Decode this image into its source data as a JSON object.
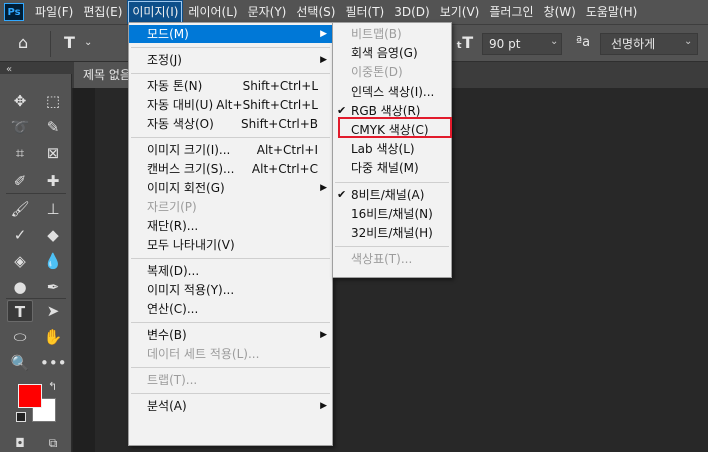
{
  "app_logo": "Ps",
  "menubar": [
    "파일(F)",
    "편집(E)",
    "이미지(I)",
    "레이어(L)",
    "문자(Y)",
    "선택(S)",
    "필터(T)",
    "3D(D)",
    "보기(V)",
    "플러그인",
    "창(W)",
    "도움말(H)"
  ],
  "options": {
    "font_size": "90 pt",
    "aa_icon": "ªa",
    "antialias": "선명하게"
  },
  "document_tab": "제목 없음",
  "image_menu": [
    {
      "label": "모드(M)",
      "submenu": true,
      "highlight": true
    },
    {
      "sep": true
    },
    {
      "label": "조정(J)",
      "submenu": true
    },
    {
      "sep": true
    },
    {
      "label": "자동 톤(N)",
      "shortcut": "Shift+Ctrl+L"
    },
    {
      "label": "자동 대비(U)",
      "shortcut": "Alt+Shift+Ctrl+L"
    },
    {
      "label": "자동 색상(O)",
      "shortcut": "Shift+Ctrl+B"
    },
    {
      "sep": true
    },
    {
      "label": "이미지 크기(I)...",
      "shortcut": "Alt+Ctrl+I"
    },
    {
      "label": "캔버스 크기(S)...",
      "shortcut": "Alt+Ctrl+C"
    },
    {
      "label": "이미지 회전(G)",
      "submenu": true
    },
    {
      "label": "자르기(P)",
      "disabled": true
    },
    {
      "label": "재단(R)..."
    },
    {
      "label": "모두 나타내기(V)"
    },
    {
      "sep": true
    },
    {
      "label": "복제(D)..."
    },
    {
      "label": "이미지 적용(Y)..."
    },
    {
      "label": "연산(C)..."
    },
    {
      "sep": true
    },
    {
      "label": "변수(B)",
      "submenu": true
    },
    {
      "label": "데이터 세트 적용(L)...",
      "disabled": true
    },
    {
      "sep": true
    },
    {
      "label": "트랩(T)...",
      "disabled": true
    },
    {
      "sep": true
    },
    {
      "label": "분석(A)",
      "submenu": true
    }
  ],
  "mode_menu": [
    {
      "label": "비트맵(B)",
      "disabled": true
    },
    {
      "label": "회색 음영(G)"
    },
    {
      "label": "이중톤(D)",
      "disabled": true
    },
    {
      "label": "인덱스 색상(I)..."
    },
    {
      "label": "RGB 색상(R)",
      "checked": true
    },
    {
      "label": "CMYK 색상(C)"
    },
    {
      "label": "Lab 색상(L)"
    },
    {
      "label": "다중 채널(M)"
    },
    {
      "sep": true
    },
    {
      "label": "8비트/채널(A)",
      "checked": true
    },
    {
      "label": "16비트/채널(N)"
    },
    {
      "label": "32비트/채널(H)"
    },
    {
      "sep": true
    },
    {
      "label": "색상표(T)...",
      "disabled": true
    }
  ],
  "colors": {
    "foreground": "#ff0000",
    "background": "#ffffff",
    "menu_highlight": "#0078d7",
    "callout": "#e21b2c"
  }
}
